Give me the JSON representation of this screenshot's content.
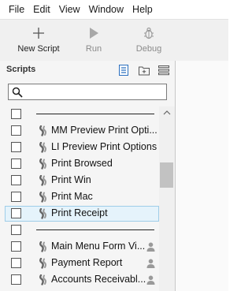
{
  "menubar": {
    "items": [
      "File",
      "Edit",
      "View",
      "Window",
      "Help"
    ]
  },
  "toolbar": {
    "new_script": "New Script",
    "run": "Run",
    "debug": "Debug"
  },
  "panel": {
    "title": "Scripts",
    "search": {
      "value": "",
      "placeholder": ""
    },
    "rows": [
      {
        "type": "separator"
      },
      {
        "type": "script",
        "label": "MM Preview Print Opti..."
      },
      {
        "type": "script",
        "label": "LI Preview Print Options"
      },
      {
        "type": "script",
        "label": "Print Browsed"
      },
      {
        "type": "script",
        "label": "Print Win"
      },
      {
        "type": "script",
        "label": "Print Mac"
      },
      {
        "type": "script",
        "label": "Print Receipt",
        "selected": true
      },
      {
        "type": "separator"
      },
      {
        "type": "script",
        "label": "Main Menu Form Vi...",
        "user_icon": true
      },
      {
        "type": "script",
        "label": "Payment Report",
        "user_icon": true
      },
      {
        "type": "script",
        "label": "Accounts Receivabl...",
        "user_icon": true
      }
    ]
  },
  "colors": {
    "selection_bg": "#e5f3fb",
    "selection_border": "#9fcde8",
    "accent_icon": "#2a6fbf"
  }
}
